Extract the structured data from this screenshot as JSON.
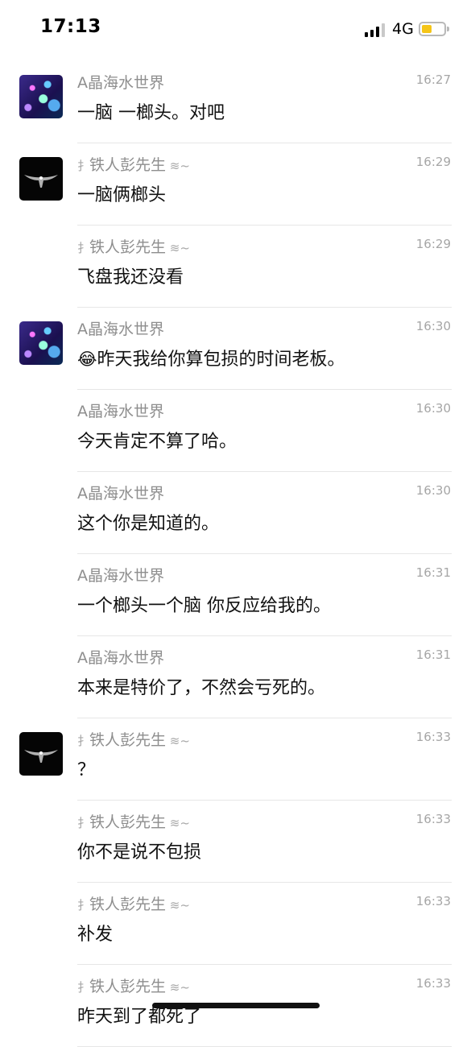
{
  "status_bar": {
    "time": "17:13",
    "network": "4G",
    "battery_level": 0.45
  },
  "messages": [
    {
      "sender": "A晶海水世界",
      "time": "16:27",
      "text": "一脑 一榔头。对吧",
      "avatar": "reef-avatar"
    },
    {
      "sender": "铁人彭先生",
      "time": "16:29",
      "text": "一脑俩榔头",
      "avatar": "stingray-avatar"
    },
    {
      "sender": "铁人彭先生",
      "time": "16:29",
      "text": "飞盘我还没看"
    },
    {
      "sender": "A晶海水世界",
      "time": "16:30",
      "text": "昨天我给你算包损的时间老板。",
      "emoji": "😂",
      "avatar": "reef-avatar"
    },
    {
      "sender": "A晶海水世界",
      "time": "16:30",
      "text": "今天肯定不算了哈。"
    },
    {
      "sender": "A晶海水世界",
      "time": "16:30",
      "text": "这个你是知道的。"
    },
    {
      "sender": "A晶海水世界",
      "time": "16:31",
      "text": "一个榔头一个脑 你反应给我的。"
    },
    {
      "sender": "A晶海水世界",
      "time": "16:31",
      "text": "本来是特价了，不然会亏死的。"
    },
    {
      "sender": "铁人彭先生",
      "time": "16:33",
      "text": "？",
      "avatar": "stingray-avatar"
    },
    {
      "sender": "铁人彭先生",
      "time": "16:33",
      "text": "你不是说不包损"
    },
    {
      "sender": "铁人彭先生",
      "time": "16:33",
      "text": "补发"
    },
    {
      "sender": "铁人彭先生",
      "time": "16:33",
      "text": "昨天到了都死了"
    }
  ],
  "sender_decorations": {
    "prefix": "⺘",
    "suffix": "≋~"
  }
}
